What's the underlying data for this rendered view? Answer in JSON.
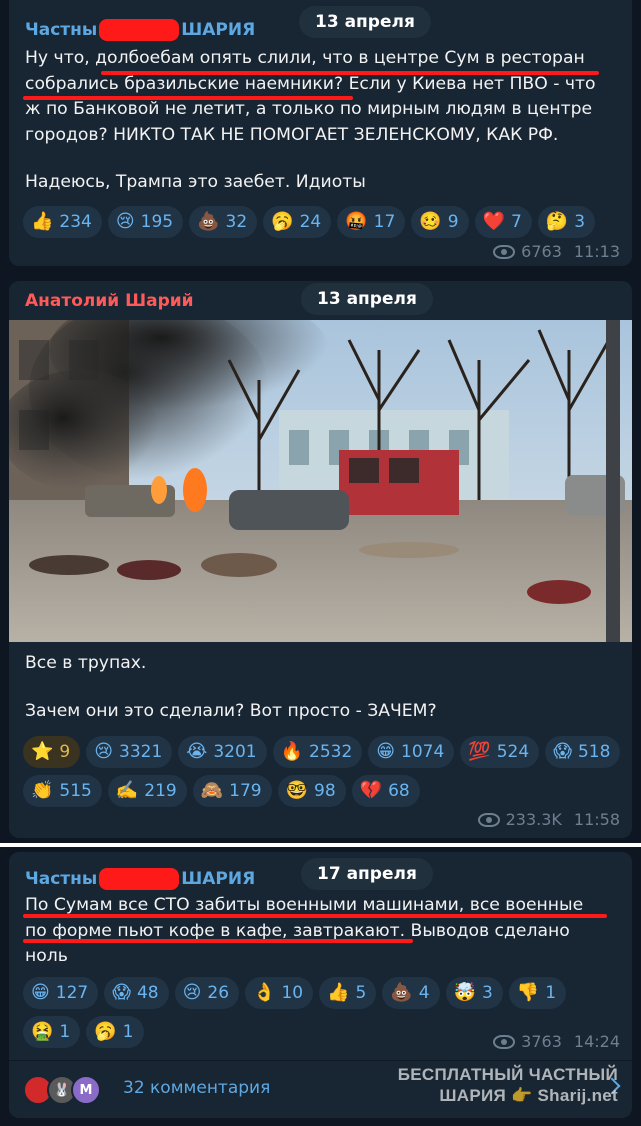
{
  "posts": [
    {
      "author_prefix": "Частны",
      "author_suffix": "ШАРИЯ",
      "date": "13 апреля",
      "text_lines": [
        "Ну что, долбоебам опять слили, что в центре Сум в ресторан",
        "собрались бразильские наемники? Если у Киева нет ПВО - что",
        "ж по Банковой не летит, а только по мирным людям в центре",
        "городов? НИКТО ТАК НЕ ПОМОГАЕТ ЗЕЛЕНСКОМУ, КАК РФ.",
        "",
        "Надеюсь, Трампа это заебет. Идиоты"
      ],
      "reactions": [
        {
          "icon": "👍",
          "count": "234"
        },
        {
          "icon": "😢",
          "count": "195"
        },
        {
          "icon": "💩",
          "count": "32"
        },
        {
          "icon": "🥱",
          "count": "24"
        },
        {
          "icon": "🤬",
          "count": "17"
        },
        {
          "icon": "🥴",
          "count": "9"
        },
        {
          "icon": "❤️",
          "count": "7"
        },
        {
          "icon": "🤔",
          "count": "3"
        }
      ],
      "views": "6763",
      "time": "11:13"
    },
    {
      "author": "Анатолий Шарий",
      "date": "13 апреля",
      "text_lines": [
        "Все в трупах.",
        "",
        "Зачем они это сделали? Вот просто - ЗАЧЕМ?"
      ],
      "reactions": [
        {
          "icon": "⭐",
          "count": "9",
          "paid": true
        },
        {
          "icon": "😢",
          "count": "3321"
        },
        {
          "icon": "😭",
          "count": "3201"
        },
        {
          "icon": "🔥",
          "count": "2532"
        },
        {
          "icon": "😁",
          "count": "1074"
        },
        {
          "icon": "💯",
          "count": "524"
        },
        {
          "icon": "😱",
          "count": "518"
        },
        {
          "icon": "👏",
          "count": "515"
        },
        {
          "icon": "✍️",
          "count": "219"
        },
        {
          "icon": "🙈",
          "count": "179"
        },
        {
          "icon": "🤓",
          "count": "98"
        },
        {
          "icon": "💔",
          "count": "68"
        }
      ],
      "views": "233.3K",
      "time": "11:58"
    },
    {
      "author_prefix": "Частны",
      "author_suffix": "ШАРИЯ",
      "date": "17 апреля",
      "text_lines": [
        "По Сумам все СТО забиты военными машинами, все военные",
        "по форме пьют кофе в кафе, завтракают. Выводов сделано",
        "ноль"
      ],
      "reactions": [
        {
          "icon": "😁",
          "count": "127"
        },
        {
          "icon": "😱",
          "count": "48"
        },
        {
          "icon": "😢",
          "count": "26"
        },
        {
          "icon": "👌",
          "count": "10"
        },
        {
          "icon": "👍",
          "count": "5"
        },
        {
          "icon": "💩",
          "count": "4"
        },
        {
          "icon": "🤯",
          "count": "3"
        },
        {
          "icon": "👎",
          "count": "1"
        },
        {
          "icon": "🤮",
          "count": "1"
        },
        {
          "icon": "🥱",
          "count": "1"
        }
      ],
      "views": "3763",
      "time": "14:24",
      "comments_label": "32 комментария",
      "comment_avatar_letter": "M"
    }
  ],
  "watermark": {
    "line1": "БЕСПЛАТНЫЙ ЧАСТНЫЙ",
    "line2": "ШАРИЯ 👉 Sharij.net"
  },
  "colors": {
    "background": "#0e1621",
    "bubble": "#182533",
    "link": "#5ea8e2",
    "redaction": "#ff1a1a",
    "author_red": "#ff5a5a"
  }
}
